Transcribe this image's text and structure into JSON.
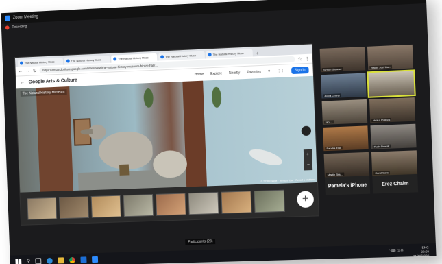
{
  "zoom": {
    "window_title": "Zoom Meeting",
    "recording_label": "Recording",
    "win_controls": [
      "–",
      "□",
      "×"
    ]
  },
  "browser": {
    "tabs": [
      {
        "label": "The Natural History Muse"
      },
      {
        "label": "The Natural History Muse"
      },
      {
        "label": "The Natural History Muse"
      },
      {
        "label": "The Natural History Muse"
      },
      {
        "label": "The Natural History Muse"
      }
    ],
    "url": "https://artsandculture.google.com/streetview/the-natural-history-museum-hintze-hall/...",
    "site_title": "Google Arts & Culture",
    "nav": [
      "Home",
      "Explore",
      "Nearby",
      "Favorites"
    ],
    "signin": "Sign in",
    "museum_label": "The Natural History Museum",
    "copyright": "© 2018 Google · Terms of Use · Report a problem"
  },
  "gallery": {
    "participants": [
      {
        "name": "Simon Stewart"
      },
      {
        "name": "Rabbi Joel Ka..."
      },
      {
        "name": "Aviva Lehrer"
      },
      {
        "name": ""
      },
      {
        "name": "Ian ..."
      },
      {
        "name": "Helen Pollock"
      },
      {
        "name": "Sandra Fiat"
      },
      {
        "name": "Ruth Stranik"
      },
      {
        "name": "Martin Bra..."
      },
      {
        "name": "Carol Sara"
      }
    ],
    "big_names": [
      "Pamela's iPhone",
      "Erez Chaim"
    ]
  },
  "taskbar": {
    "tray_lang": "ENG",
    "time": "20:59",
    "date": "21/10/2020",
    "tray_extra": "^ ⌨ ◫ ☊"
  },
  "bottom_label": "Participants (23)"
}
